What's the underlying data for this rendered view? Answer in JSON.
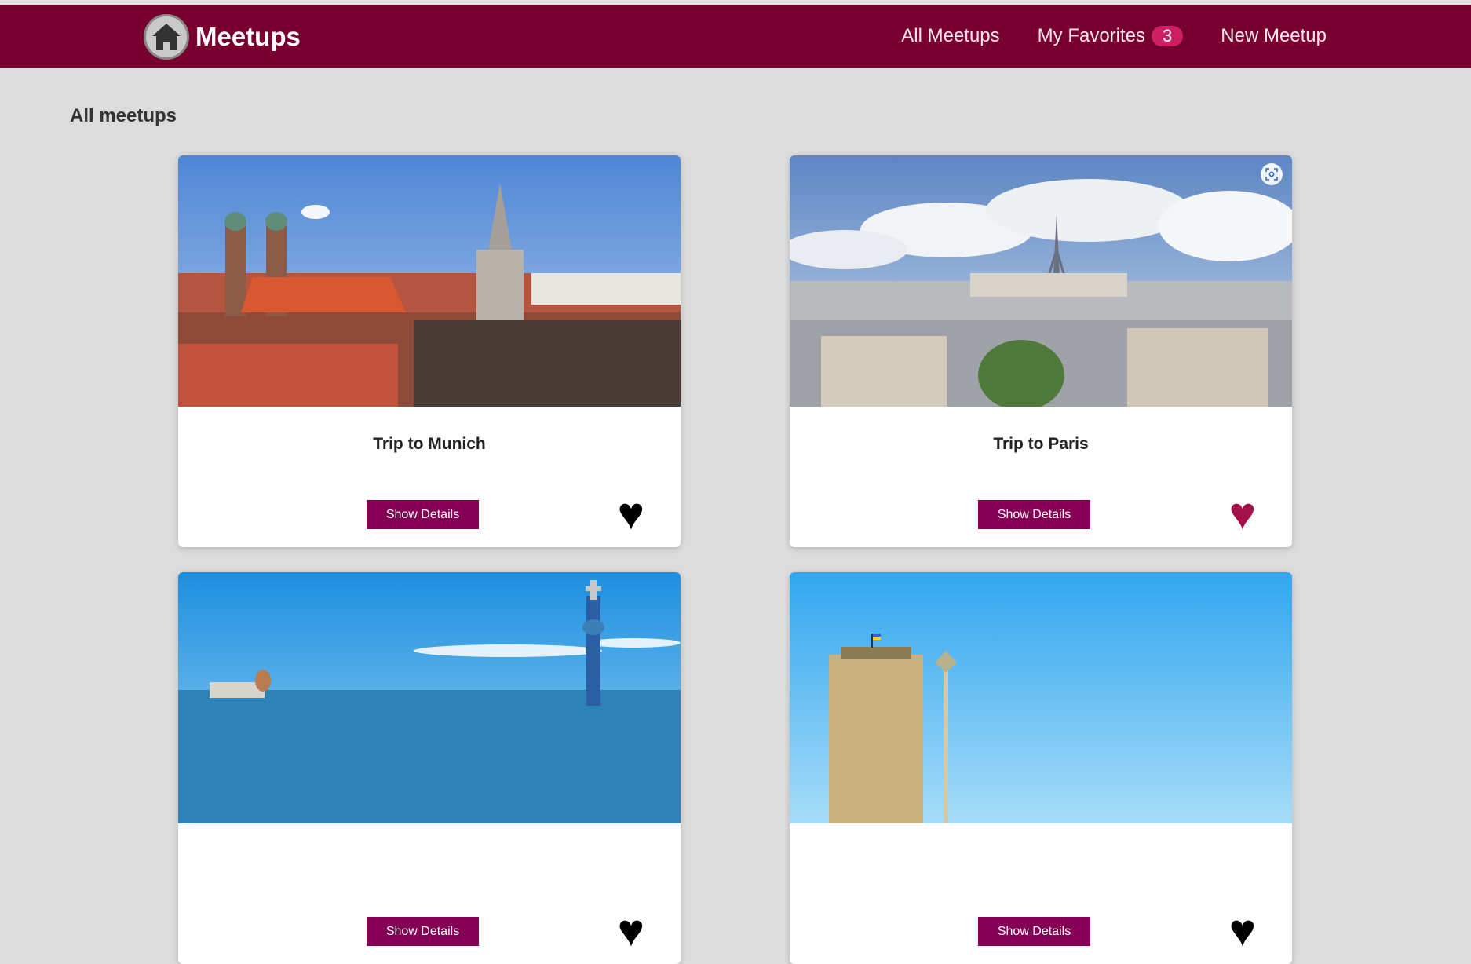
{
  "header": {
    "title": "Meetups",
    "logo_icon": "home-icon",
    "nav": {
      "all_meetups": "All Meetups",
      "my_favorites": "My Favorites",
      "favorites_count": "3",
      "new_meetup": "New Meetup"
    }
  },
  "main": {
    "heading": "All meetups",
    "meetups": [
      {
        "title": "Trip to Munich",
        "button": "Show Details",
        "favorite": false,
        "heart": "♥"
      },
      {
        "title": "Trip to Paris",
        "button": "Show Details",
        "favorite": true,
        "heart": "♥"
      },
      {
        "title": "",
        "button": "Show Details",
        "favorite": false,
        "heart": "♥"
      },
      {
        "title": "",
        "button": "Show Details",
        "favorite": false,
        "heart": "♥"
      }
    ]
  },
  "colors": {
    "header_bg": "#77002e",
    "accent": "#850054",
    "badge": "#cc2062",
    "heart_favorite": "#a5104a",
    "heart_default": "#000000"
  }
}
